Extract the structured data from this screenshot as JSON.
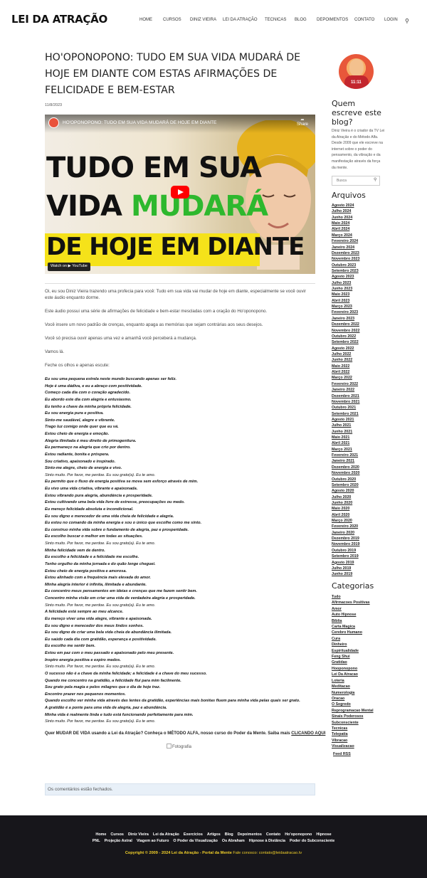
{
  "header": {
    "logo": "LEI DA ATRAÇÃO",
    "nav": [
      "Home",
      "CURSOS",
      "DINIZ VIEIRA",
      "LEI DA ATRAÇÃO",
      "TECNICAS",
      "BLOG",
      "DEPOIMENTOS",
      "CONTATO",
      "LOGIN"
    ],
    "search_icon": "search-icon"
  },
  "post": {
    "title": "HO'OPONOPONO: TUDO EM SUA VIDA MUDARÁ DE HOJE EM DIANTE COM ESTAS AFIRMAÇÕES DE FELICIDADE E BEM-ESTAR",
    "date": "11/8/2023",
    "video": {
      "title": "HO'OPONOPONO: TUDO EM SUA VIDA MUDARÁ DE HOJE EM DIANTE",
      "share": "Share",
      "line1": "TUDO EM SUA",
      "line2a": "VIDA ",
      "line2b": "MUDARÁ",
      "line3": "DE HOJE EM DIANTE",
      "watch": "Watch on",
      "youtube": "YouTube",
      "accent": "#2eb82e",
      "banner": "#f5e21a"
    },
    "paragraphs": [
      "Oi, eu sou Diniz Vieira trazendo uma profecia para você: Tudo em sua vida vai mudar de hoje em diante, especialmente se você ouvir este áudio enquanto dorme.",
      "Este áudio possui uma série de afirmações de felicidade e bem-estar mescladas com a oração do Ho'oponopono.",
      "Você insere um novo padrão de crenças, enquanto apaga as memórias que sejam contrárias aos seus desejos.",
      "Você só precisa ouvir apenas uma vez e amanhã você perceberá a mudança.",
      "Vamos lá.",
      "Feche os olhos e apenas escute:"
    ],
    "affirmations": [
      "Eu sou uma pequena estrela neste mundo buscando apenas ser feliz.",
      "Hoje é uma dádiva, e eu a abraço com positividade.",
      "Começo cada dia com o coração agradecido.",
      "Eu abordo este dia com alegria e entusiasmo.",
      "Eu tenho a chave da minha própria felicidade.",
      "Eu sou energia pura e positiva.",
      "Sinto-me saudável, alegre e vibrante.",
      "Trago luz comigo onde quer que eu vá.",
      "Estou cheio de energia e emoção.",
      "Alegria ilimitada é meu direito de primogenitura.",
      "Eu permaneço na alegria que crio por dentro.",
      "Estou radiante, bonita e próspera.",
      "Sou criativo, apaixonado e inspirado.",
      "Sinto-me alegre, cheio de energia e vivo.",
      "Sinto muito. Por favor, me perdoe. Eu sou grato(a). Eu te amo.",
      "Eu permito que o fluxo de energia positiva se mova sem esforço através de mim.",
      "Eu vivo uma vida criativa, vibrante e apaixonada.",
      "Estou vibrando pura alegria, abundância e prosperidade.",
      "Estou cultivando uma bela vida livre de estresse, preocupações ou medo.",
      "Eu mereço felicidade absoluta e incondicional.",
      "Eu sou digno e merecedor de uma vida cheia de felicidade e alegria.",
      "Eu estou no comando da minha energia e sou o único que escolhe como me sinto.",
      "Eu construo minha vida sobre o fundamento de alegria, paz e prosperidade.",
      "Eu escolho buscar o melhor em todas as situações.",
      "Sinto muito. Por favor, me perdoe. Eu sou grato(a). Eu te amo.",
      "Minha felicidade vem de dentro.",
      "Eu escolho a felicidade e a felicidade me escolhe.",
      "Tenho orgulho da minha jornada e do quão longe cheguei.",
      "Estou cheio de energia positiva e amorosa.",
      "Estou alinhado com a frequência mais elevada do amor.",
      "Minha alegria interior é infinita, ilimitada e abundante.",
      "Eu concentro meus pensamentos em ideias e crenças que me fazem sentir bem.",
      "Concentro minha visão em criar uma vida de verdadeira alegria e prosperidade.",
      "Sinto muito. Por favor, me perdoe. Eu sou grato(a). Eu te amo.",
      "A felicidade está sempre ao meu alcance.",
      "Eu mereço viver uma vida alegre, vibrante e apaixonada.",
      "Eu sou digno e merecedor dos meus lindos sonhos.",
      "Eu sou digno de criar uma bela vida cheia de abundância ilimitada.",
      "Eu saúdo cada dia com gratidão, esperança e positividade.",
      "Eu escolho me sentir bem.",
      "Estou em paz com o meu passado e apaixonado pelo meu presente.",
      "Inspiro energia positiva e expiro medos.",
      "Sinto muito. Por favor, me perdoe. Eu sou grato(a). Eu te amo.",
      "O sucesso não é a chave da minha felicidade; a felicidade é a chave do meu sucesso.",
      "Quando me concentro na gratidão, a felicidade flui para mim facilmente.",
      "Sou grato pela magia e pelos milagres que o dia de hoje traz.",
      "Encontro prazer nos pequenos momentos.",
      "Quando escolho ver minha vida através das lentes da gratidão, experiências mais bonitas fluem para minha vida pelas quais ser grato.",
      "A gratidão é a ponte para uma vida de alegria, paz e abundância.",
      "Minha vida é realmente linda e tudo está funcionando perfeitamente para mim.",
      "Sinto muito. Por favor, me perdoe. Eu sou grato(a). Eu te amo."
    ],
    "cta_text": "Quer MUDAR DE VIDA usando a Lei da Atração? Conheça o MÉTODO ALFA, nosso curso do Poder da Mente. Saiba mais ",
    "cta_link": "CLICANDO AQUI",
    "photo_alt": "Fotografia",
    "comments_closed": "Os comentários estão fechados."
  },
  "sidebar": {
    "avatar_text": "11:11",
    "about_title": "Quem escreve este blog?",
    "about_text": "Diniz Vieira é o criador da TV Lei da Atração e do Método Alfa. Desde 2009 que ele escreve na internet sobre o poder do pensamento, da vibração e da manifestação através da força da mente.",
    "search_placeholder": "Busca",
    "archives_title": "Arquivos",
    "archives": [
      "Agosto 2024",
      "Julho 2024",
      "Junho 2024",
      "Maio 2024",
      "Abril 2024",
      "Março 2024",
      "Fevereiro 2024",
      "Janeiro 2024",
      "Dezembro 2023",
      "Novembro 2023",
      "Outubro 2023",
      "Setembro 2023",
      "Agosto 2023",
      "Julho 2023",
      "Junho 2023",
      "Maio 2023",
      "Abril 2023",
      "Março 2023",
      "Fevereiro 2023",
      "Janeiro 2023",
      "Dezembro 2022",
      "Novembro 2022",
      "Outubro 2022",
      "Setembro 2022",
      "Agosto 2022",
      "Julho 2022",
      "Junho 2022",
      "Maio 2022",
      "Abril 2022",
      "Março 2022",
      "Fevereiro 2022",
      "Janeiro 2022",
      "Dezembro 2021",
      "Novembro 2021",
      "Outubro 2021",
      "Setembro 2021",
      "Agosto 2021",
      "Julho 2021",
      "Junho 2021",
      "Maio 2021",
      "Abril 2021",
      "Março 2021",
      "Fevereiro 2021",
      "Janeiro 2021",
      "Dezembro 2020",
      "Novembro 2020",
      "Outubro 2020",
      "Setembro 2020",
      "Agosto 2020",
      "Julho 2020",
      "Junho 2020",
      "Maio 2020",
      "Abril 2020",
      "Março 2020",
      "Fevereiro 2020",
      "Janeiro 2020",
      "Dezembro 2019",
      "Novembro 2019",
      "Outubro 2019",
      "Setembro 2019",
      "Agosto 2019",
      "Julho 2019",
      "Junho 2019"
    ],
    "categories_title": "Categorias",
    "categories": [
      "Tudo",
      "Afirmacoes Positivas",
      "Amor",
      "Auto Hipnose",
      "Bíblia",
      "Carta Magica",
      "Cerebro Humano",
      "Cura",
      "Dinheiro",
      "Espiritualidade",
      "Feng Shui",
      "Gratidao",
      "Hooponopono",
      "Lei Da Atracao",
      "Loteria",
      "Meditacao",
      "Numerologia",
      "Oracao",
      "O Segredo",
      "Reprogramacao Mental",
      "Sinais Poderosos",
      "Subconsciente",
      "Tecnicas",
      "Telepatia",
      "Vibracao",
      "Visualizacao"
    ],
    "feed": "Feed RSS"
  },
  "footer": {
    "row1": [
      "Home",
      "Cursos",
      "Diniz Vieira",
      "Lei da Atração",
      "Exercícios",
      "Artigos",
      "Blog",
      "Depoimentos",
      "Contato",
      "Ho'oponopono",
      "Hipnose"
    ],
    "row2": [
      "PNL",
      "Projeção Astral",
      "Viagem ao Futuro",
      "O Poder da Visualização",
      "Os Abraham",
      "Hipnose à Distância",
      "Poder do Subconsciente"
    ],
    "copyright": "Copyright © 2009 - 2024 Lei da Atração - Portal da Mente",
    "contact": " Fale conosco: contato@leidaatracao.tv",
    "accent": "#f0cf2a"
  }
}
